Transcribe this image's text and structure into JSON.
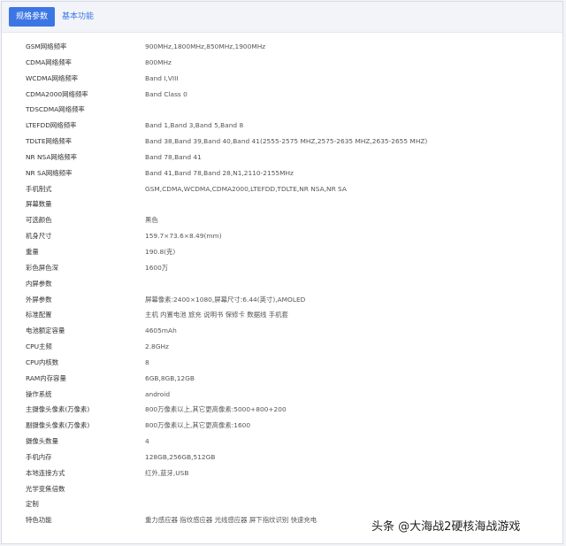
{
  "tabs": [
    {
      "label": "规格参数",
      "active": true
    },
    {
      "label": "基本功能",
      "active": false
    }
  ],
  "specs": [
    {
      "name": "GSM网络频率",
      "value": "900MHz,1800MHz,850MHz,1900MHz"
    },
    {
      "name": "CDMA网络频率",
      "value": "800MHz"
    },
    {
      "name": "WCDMA网络频率",
      "value": "Band Ⅰ,VIII"
    },
    {
      "name": "CDMA2000网络频率",
      "value": "Band Class 0"
    },
    {
      "name": "TDSCDMA网络频率",
      "value": ""
    },
    {
      "name": "LTEFDD网络频率",
      "value": "Band 1,Band 3,Band 5,Band 8"
    },
    {
      "name": "TDLTE网络频率",
      "value": "Band 38,Band 39,Band 40,Band 41(2555-2575 MHZ,2575-2635 MHZ,2635-2655 MHZ)"
    },
    {
      "name": "NR NSA网络频率",
      "value": "Band 78,Band 41"
    },
    {
      "name": "NR SA网络频率",
      "value": "Band 41,Band 78,Band 28,N1,2110-2155MHz"
    },
    {
      "name": "手机制式",
      "value": "GSM,CDMA,WCDMA,CDMA2000,LTEFDD,TDLTE,NR NSA,NR SA"
    },
    {
      "name": "屏幕数量",
      "value": ""
    },
    {
      "name": "可选颜色",
      "value": "黑色"
    },
    {
      "name": "机身尺寸",
      "value": "159.7×73.6×8.49(mm)"
    },
    {
      "name": "重量",
      "value": "190.8(克)"
    },
    {
      "name": "彩色屏色深",
      "value": "1600万"
    },
    {
      "name": "内屏参数",
      "value": ""
    },
    {
      "name": "外屏参数",
      "value": "屏幕像素:2400×1080,屏幕尺寸:6.44(英寸),AMOLED"
    },
    {
      "name": "标准配置",
      "value": "主机 内置电池 旅充 说明书 保修卡 数据线 手机套"
    },
    {
      "name": "电池额定容量",
      "value": "4605mAh"
    },
    {
      "name": "CPU主频",
      "value": "2.8GHz"
    },
    {
      "name": "CPU内核数",
      "value": "8"
    },
    {
      "name": "RAM内存容量",
      "value": "6GB,8GB,12GB"
    },
    {
      "name": "操作系统",
      "value": "android"
    },
    {
      "name": "主摄像头像素(万像素)",
      "value": "800万像素以上,其它更高像素:5000+800+200"
    },
    {
      "name": "副摄像头像素(万像素)",
      "value": "800万像素以上,其它更高像素:1600"
    },
    {
      "name": "摄像头数量",
      "value": "4"
    },
    {
      "name": "手机内存",
      "value": "128GB,256GB,512GB"
    },
    {
      "name": "本地连接方式",
      "value": "红外,蓝牙,USB"
    },
    {
      "name": "光学变焦倍数",
      "value": ""
    },
    {
      "name": "定制",
      "value": ""
    },
    {
      "name": "特色功能",
      "value": "重力感应器 指纹感应器 光线感应器 屏下指纹识别 快速充电"
    }
  ],
  "watermark": "头条 @大海战2硬核海战游戏"
}
